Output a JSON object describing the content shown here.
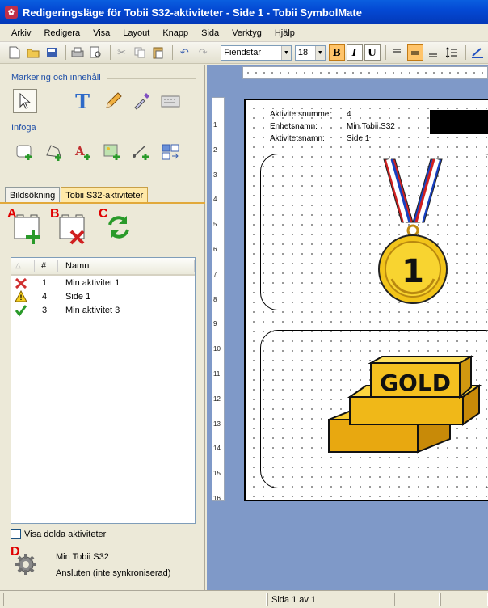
{
  "window": {
    "title": "Redigeringsläge för Tobii S32-aktiviteter - Side 1 - Tobii SymbolMate"
  },
  "menu": [
    "Arkiv",
    "Redigera",
    "Visa",
    "Layout",
    "Knapp",
    "Sida",
    "Verktyg",
    "Hjälp"
  ],
  "toolbar": {
    "font_name": "Fiendstar",
    "font_size": "18",
    "bold": "B",
    "italic": "I",
    "underline": "U"
  },
  "left_panel": {
    "section_selection": "Markering och innehåll",
    "section_insert": "Infoga",
    "tabs": [
      "Bildsökning",
      "Tobii S32-aktiviteter"
    ],
    "active_tab": 1,
    "action_letters": [
      "A",
      "B",
      "C",
      "D"
    ],
    "list": {
      "columns": [
        "#",
        "Namn"
      ],
      "rows": [
        {
          "status": "error",
          "num": "1",
          "name": "Min aktivitet 1"
        },
        {
          "status": "warning",
          "num": "4",
          "name": "Side 1"
        },
        {
          "status": "ok",
          "num": "3",
          "name": "Min aktivitet 3"
        }
      ]
    },
    "show_hidden_label": "Visa dolda aktiviteter",
    "show_hidden_checked": false,
    "device_name": "Min Tobii S32",
    "device_status": "Ansluten (inte synkroniserad)"
  },
  "page": {
    "activity_number_label": "Aktivitetsnummer",
    "activity_number_value": "4",
    "unit_name_label": "Enhetsnamn:",
    "unit_name_value": "Min Tobii S32",
    "activity_name_label": "Aktivitetsnamn:",
    "activity_name_value": "Side 1",
    "medal_text": "1",
    "gold_text": "GOLD"
  },
  "ruler": {
    "vertical_numbers": [
      "1",
      "2",
      "3",
      "4",
      "5",
      "6",
      "7",
      "8",
      "9",
      "10",
      "11",
      "12",
      "13",
      "14",
      "15",
      "16"
    ]
  },
  "status": {
    "page": "Sida 1 av 1"
  }
}
